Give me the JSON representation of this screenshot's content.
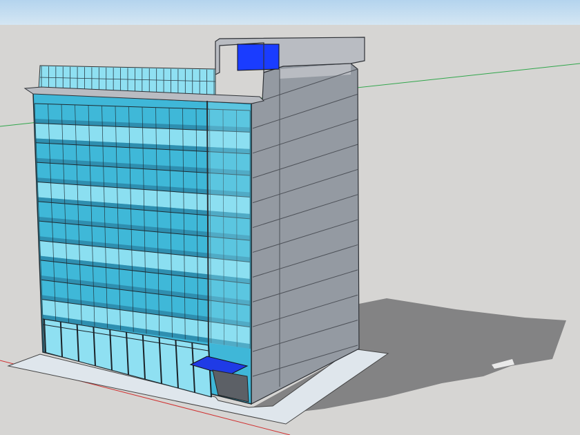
{
  "app": {
    "view": "3d-model-viewport"
  },
  "colors": {
    "sky_top": "#b4d4ee",
    "sky_bottom": "#d4e6f3",
    "ground": "#d6d5d3",
    "glass": "#3fb7d8",
    "glass_light": "#8fe0f2",
    "glass_dark": "#2e8fb0",
    "wall_side": "#949aa2",
    "wall_light": "#b9bcc2",
    "roof_glass": "#1a3cff",
    "canopy": "#1f3be6",
    "shadow": "#838384",
    "pavement": "#dfe6ec",
    "axis_red": "#d03030",
    "axis_green": "#2fa64a"
  },
  "model": {
    "object": "office-building",
    "floors": 11,
    "facade": "glass-curtain-wall",
    "entrance_canopy": true,
    "rooftop_structure": true
  }
}
